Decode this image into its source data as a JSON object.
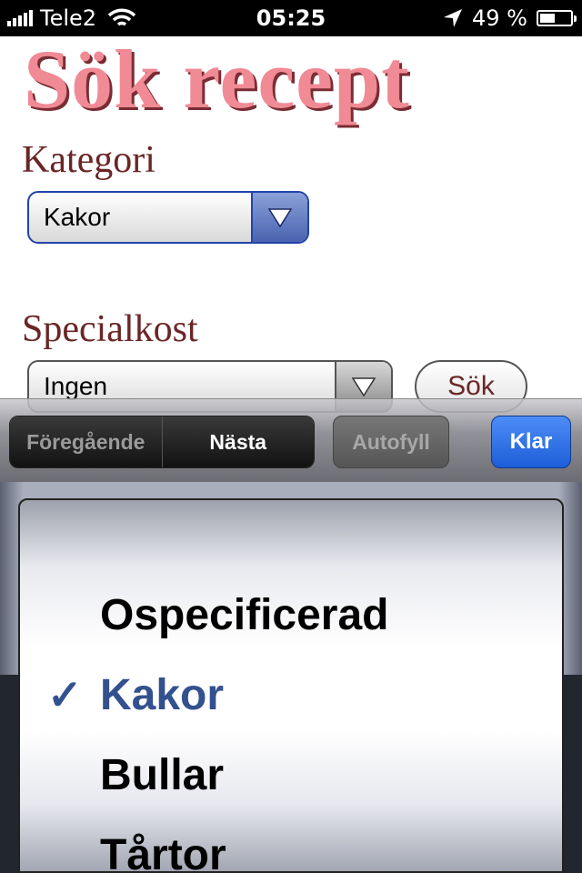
{
  "status_bar": {
    "carrier": "Tele2",
    "time": "05:25",
    "battery_text": "49 %",
    "battery_level": 0.49,
    "icons": [
      "signal-bars-icon",
      "wifi-icon",
      "location-arrow-icon",
      "battery-icon"
    ]
  },
  "page": {
    "title": "Sök recept",
    "category_label": "Kategori",
    "category_value": "Kakor",
    "diet_label": "Specialkost",
    "diet_value": "Ingen",
    "search_button": "Sök"
  },
  "accessory_bar": {
    "previous": "Föregående",
    "next": "Nästa",
    "autofill": "Autofyll",
    "done": "Klar"
  },
  "picker": {
    "options": [
      "Ospecificerad",
      "Kakor",
      "Bullar",
      "Tårtor"
    ],
    "selected": "Kakor",
    "check_glyph": "✓"
  },
  "colors": {
    "title_pink": "#f08a95",
    "label_maroon": "#6a2626",
    "select_focus_blue": "#2244aa",
    "done_blue": "#1d5ed8",
    "picker_selected": "#33518f"
  }
}
